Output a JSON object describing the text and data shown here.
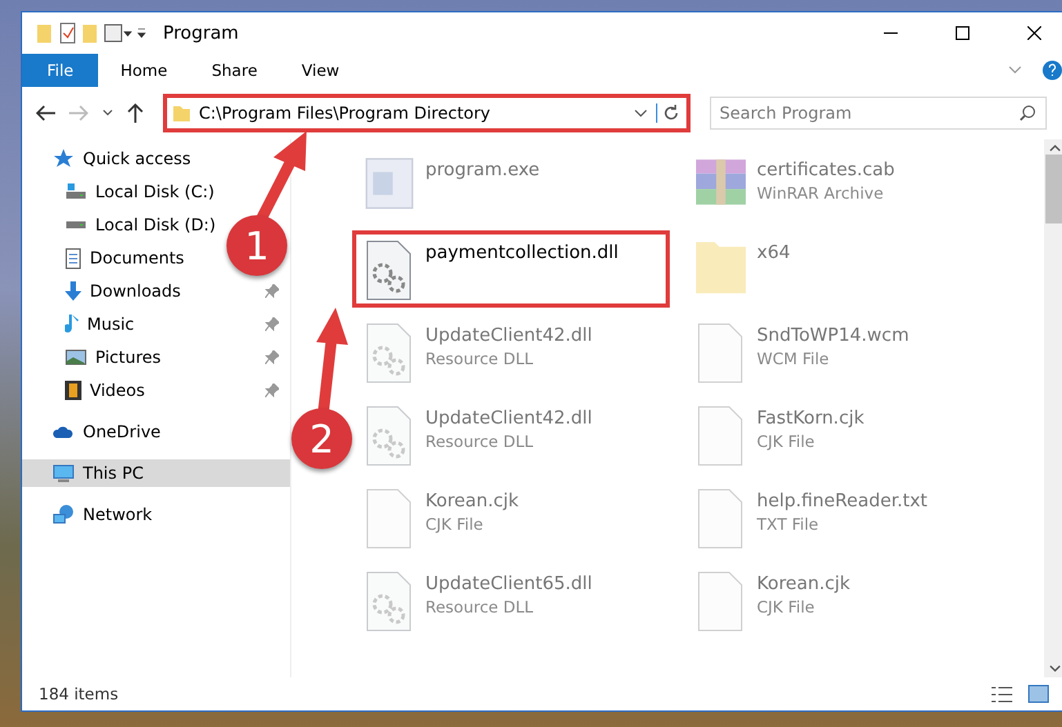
{
  "window": {
    "title": "Program"
  },
  "ribbon_tabs": [
    {
      "label": "File",
      "kind": "file"
    },
    {
      "label": "Home",
      "kind": "tab"
    },
    {
      "label": "Share",
      "kind": "tab"
    },
    {
      "label": "View",
      "kind": "tab"
    }
  ],
  "address_bar": {
    "path": "C:\\Program Files\\Program Directory",
    "highlighted": true
  },
  "search": {
    "placeholder": "Search Program"
  },
  "sidebar": {
    "items": [
      {
        "label": "Quick access",
        "kind": "star",
        "selected": false,
        "children": [
          {
            "label": "Local Disk (C:)",
            "kind": "systemdrive",
            "pinned": false,
            "selected": false
          },
          {
            "label": "Local Disk (D:)",
            "kind": "drive",
            "pinned": false,
            "selected": false
          },
          {
            "label": "Documents",
            "kind": "documents",
            "pinned": false,
            "selected": false
          },
          {
            "label": "Downloads",
            "kind": "downloads",
            "pinned": true,
            "selected": false
          },
          {
            "label": "Music",
            "kind": "music",
            "pinned": true,
            "selected": false
          },
          {
            "label": "Pictures",
            "kind": "pictures",
            "pinned": true,
            "selected": false
          },
          {
            "label": "Videos",
            "kind": "videos",
            "pinned": true,
            "selected": false
          }
        ]
      },
      {
        "label": "OneDrive",
        "kind": "cloud",
        "selected": false
      },
      {
        "label": "This PC",
        "kind": "computer",
        "selected": true
      },
      {
        "label": "Network",
        "kind": "network",
        "selected": false
      }
    ]
  },
  "files": [
    {
      "name": "program.exe",
      "kind": "program",
      "faded": true,
      "highlighted": false
    },
    {
      "name": "certificates.cab",
      "type": "WinRAR Archive",
      "kind": "archive",
      "faded": true,
      "highlighted": false
    },
    {
      "name": "paymentcollection.dll",
      "kind": "library",
      "faded": false,
      "highlighted": true
    },
    {
      "name": "x64",
      "kind": "folder",
      "faded": true,
      "highlighted": false
    },
    {
      "name": "UpdateClient42.dll",
      "type": "Resource DLL",
      "kind": "library",
      "faded": true,
      "highlighted": false
    },
    {
      "name": "SndToWP14.wcm",
      "type": "WCM File",
      "kind": "file",
      "faded": true,
      "highlighted": false
    },
    {
      "name": "UpdateClient42.dll",
      "type": "Resource DLL",
      "kind": "library",
      "faded": true,
      "highlighted": false
    },
    {
      "name": "FastKorn.cjk",
      "type": "CJK File",
      "kind": "file",
      "faded": true,
      "highlighted": false
    },
    {
      "name": "Korean.cjk",
      "type": "CJK File",
      "kind": "file",
      "faded": true,
      "highlighted": false
    },
    {
      "name": "help.fineReader.txt",
      "type": "TXT File",
      "kind": "file",
      "faded": true,
      "highlighted": false
    },
    {
      "name": "UpdateClient65.dll",
      "type": "Resource DLL",
      "kind": "library",
      "faded": true,
      "highlighted": false
    },
    {
      "name": "Korean.cjk",
      "type": "CJK File",
      "kind": "file",
      "faded": true,
      "highlighted": false
    }
  ],
  "status_bar": {
    "count": "184 items"
  },
  "annotations": [
    {
      "number": "1"
    },
    {
      "number": "2"
    }
  ]
}
